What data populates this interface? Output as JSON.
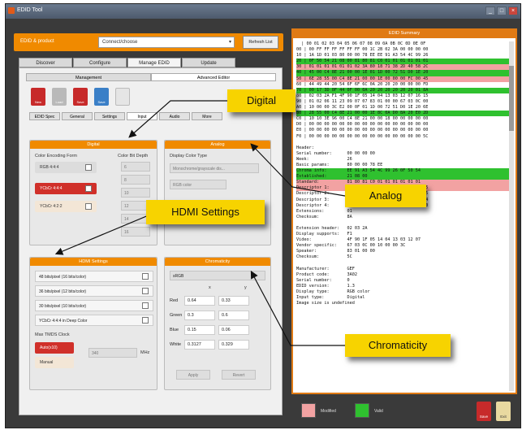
{
  "window": {
    "title": "EDID Tool"
  },
  "connection": {
    "label": "EDID & product",
    "selected": "Connect/choose",
    "reload_button": "Refresh List"
  },
  "main_tabs": [
    {
      "label": "Discover"
    },
    {
      "label": "Configure"
    },
    {
      "label": "Manage EDID"
    },
    {
      "label": "Update"
    }
  ],
  "sub_tabs": [
    {
      "label": "Management"
    },
    {
      "label": "Advanced Editor"
    }
  ],
  "toolbar": [
    {
      "label": "New",
      "color": "red"
    },
    {
      "label": "Load",
      "color": "gray"
    },
    {
      "label": "Save",
      "color": "red"
    },
    {
      "label": "Save",
      "color": "blue"
    },
    {
      "label": "",
      "color": "light"
    }
  ],
  "editor_tabs": [
    {
      "label": "EDID Spec"
    },
    {
      "label": "General"
    },
    {
      "label": "Settings"
    },
    {
      "label": "Input"
    },
    {
      "label": "Audio"
    },
    {
      "label": "More"
    }
  ],
  "digital": {
    "header": "Digital",
    "encoding_label": "Color Encoding Form",
    "bit_label": "Color Bit Depth",
    "options": [
      {
        "label": "RGB 4:4:4",
        "style": "gray"
      },
      {
        "label": "YCbCr 4:4:4",
        "style": "red"
      },
      {
        "label": "YCbCr 4:2:2",
        "style": "pale"
      }
    ],
    "bits": [
      "6",
      "8",
      "10",
      "12",
      "14",
      "16"
    ]
  },
  "analog": {
    "header": "Analog",
    "sub_label": "Display Color Type",
    "select": "Monochrome/grayscale dis...",
    "field": "RGB color"
  },
  "hdmi": {
    "header": "HDMI Settings",
    "rows": [
      {
        "label": "48 bits/pixel (16 bits/color)"
      },
      {
        "label": "36 bits/pixel (12 bits/color)"
      },
      {
        "label": "30 bits/pixel (10 bits/color)"
      },
      {
        "label": "YCbCr 4:4:4 in Deep Color"
      }
    ],
    "tmds_label": "Max TMDS Clock",
    "auto_button": "Auto(x10)",
    "manual_button": "Manual",
    "mhz_value": "340",
    "mhz_unit": "MHz"
  },
  "chroma": {
    "header": "Chromaticity",
    "select": "sRGB",
    "col_x": "x",
    "col_y": "y",
    "rows": [
      {
        "k": "Red",
        "x": "0.64",
        "y": "0.33"
      },
      {
        "k": "Green",
        "x": "0.3",
        "y": "0.6"
      },
      {
        "k": "Blue",
        "x": "0.15",
        "y": "0.06"
      },
      {
        "k": "White",
        "x": "0.3127",
        "y": "0.329"
      }
    ],
    "btn1": "Apply",
    "btn2": "Revert"
  },
  "edid_panel": {
    "header": "EDID Summary",
    "lines": [
      "  | 00 01 02 03 04 05 06 07 08 09 0A 0B 0C 0D 0E 0F",
      "00 | 00 FF FF FF FF FF FF 00 1C 2B 02 3A 00 00 00 00",
      "10 | 1A 1D 01 03 80 00 00 78 EE EE 91 A3 54 4C 99 26",
      "20 | 0F 50 54 21 08 00 81 80 81 C0 01 01 01 01 01 01",
      "30 | 01 01 01 01 01 01 02 3A 80 18 71 38 2D 40 58 2C",
      "40 | 45 00 C4 8E 21 00 00 1E 01 1D 00 72 51 D0 1E 20",
      "50 | 6E 28 55 00 C4 8E 21 00 00 1E 00 00 00 FC 00 45",
      "60 | 44 49 44 20 54 6F 6F 6C 0A 20 20 20 00 00 00 FD",
      "70 | 00 17 3D 0F 44 0F 00 0A 20 20 20 20 20 20 01 8A",
      "80 | 02 03 2A F1 4F 90 1F 05 14 04 13 03 12 07 16 15",
      "90 | 01 02 06 11 23 09 07 07 83 01 00 00 67 03 0C 00",
      "A0 | 10 00 00 3C E2 00 0F 01 1D 00 72 51 D0 1E 20 6E",
      "B0 | 28 55 00 C4 8E 21 00 00 1E 8C 0A D0 8A 20 E0 2D",
      "C0 | 10 10 3E 96 00 C4 8E 21 00 00 18 00 00 00 00 00",
      "D0 | 00 00 00 00 00 00 00 00 00 00 00 00 00 00 00 00",
      "E0 | 00 00 00 00 00 00 00 00 00 00 00 00 00 00 00 00",
      "F0 | 00 00 00 00 00 00 00 00 00 00 00 00 00 00 00 5C",
      "",
      "Header:",
      "Serial number:      00 00 00 00",
      "Week:               26",
      "Basic params:       80 00 00 78 EE",
      "Chroma info:        EE 91 A3 54 4C 99 26 0F 50 54",
      "Established:        21 08 00",
      "Standard:           81 80 81 C0 01 01 01 01 01 01",
      "Descriptor 1:       02 3A 80 18 71 38 2D 40 58 2C 45",
      "Descriptor 2:       01 1D 00 72 51 D0 1E 20 6E 28 55",
      "Descriptor 3:       00 00 00 FC 00 45 44 49 44 20 54",
      "Descriptor 4:       00 00 00 FD 00 17 3D 0F 44 0F 00",
      "Extensions:         01",
      "Checksum:           8A",
      "",
      "Extension header:   02 03 2A",
      "Display supports:   F1",
      "Video:              4F 90 1F 05 14 04 13 03 12 07",
      "Vendor specific:    67 03 0C 00 10 00 00 3C",
      "Speaker:            83 01 00 00",
      "Checksum:           5C",
      "",
      "Manufacturer:       GEF",
      "Product code:       3A02",
      "Serial number:      0",
      "EDID version:       1.3",
      "Display type:       RGB color",
      "Input type:         Digital",
      "Image size is undefined"
    ]
  },
  "legend": {
    "changed": "Modified",
    "valid": "Valid",
    "changed_color": "#f2a2a2",
    "valid_color": "#2fc12f"
  },
  "bottom_buttons": [
    {
      "label": "Save",
      "color": "#c72a2a"
    },
    {
      "label": "Exit",
      "color": "#e9d9a0"
    }
  ],
  "callouts": {
    "digital": "Digital",
    "analog": "Analog",
    "hdmi": "HDMI Settings",
    "chroma": "Chromaticity"
  }
}
